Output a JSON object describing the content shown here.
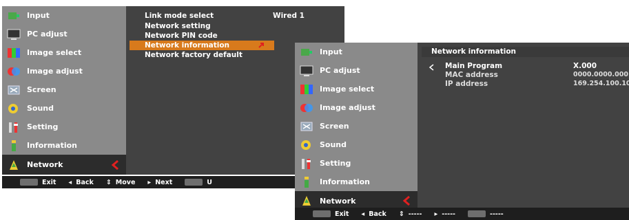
{
  "left_screen": {
    "menu": [
      {
        "icon": "input-icon",
        "label": "Input"
      },
      {
        "icon": "pc-adjust-icon",
        "label": "PC adjust"
      },
      {
        "icon": "image-select-icon",
        "label": "Image select"
      },
      {
        "icon": "image-adjust-icon",
        "label": "Image adjust"
      },
      {
        "icon": "screen-icon",
        "label": "Screen"
      },
      {
        "icon": "sound-icon",
        "label": "Sound"
      },
      {
        "icon": "setting-icon",
        "label": "Setting"
      },
      {
        "icon": "information-icon",
        "label": "Information"
      },
      {
        "icon": "network-icon",
        "label": "Network"
      }
    ],
    "submenu": {
      "items": [
        {
          "label": "Link mode select",
          "value": "Wired 1"
        },
        {
          "label": "Network setting",
          "value": ""
        },
        {
          "label": "Network PIN code",
          "value": ""
        },
        {
          "label": "Network information",
          "value": ""
        },
        {
          "label": "Network factory default",
          "value": ""
        }
      ]
    },
    "bottombar": {
      "exit": "Exit",
      "back": "Back",
      "move": "Move",
      "next": "Next",
      "more": "U"
    }
  },
  "right_screen": {
    "menu": [
      {
        "icon": "input-icon",
        "label": "Input"
      },
      {
        "icon": "pc-adjust-icon",
        "label": "PC adjust"
      },
      {
        "icon": "image-select-icon",
        "label": "Image select"
      },
      {
        "icon": "image-adjust-icon",
        "label": "Image adjust"
      },
      {
        "icon": "screen-icon",
        "label": "Screen"
      },
      {
        "icon": "sound-icon",
        "label": "Sound"
      },
      {
        "icon": "setting-icon",
        "label": "Setting"
      },
      {
        "icon": "information-icon",
        "label": "Information"
      },
      {
        "icon": "network-icon",
        "label": "Network"
      }
    ],
    "info": {
      "title": "Network information",
      "rows": [
        {
          "label": "Main Program",
          "value": "X.000"
        },
        {
          "label": "MAC address",
          "value": "0000.0000.000"
        },
        {
          "label": "IP address",
          "value": "169.254.100.10"
        }
      ]
    },
    "bottombar": {
      "exit": "Exit",
      "back": "Back",
      "move": "-----",
      "next": "-----",
      "extra": "-----"
    }
  },
  "colors": {
    "highlight": "#d87a1c",
    "menu_bg": "#8a8a8a",
    "panel_bg": "#424242",
    "selected_bg": "#2c2c2c",
    "arrow_red": "#e02020"
  }
}
